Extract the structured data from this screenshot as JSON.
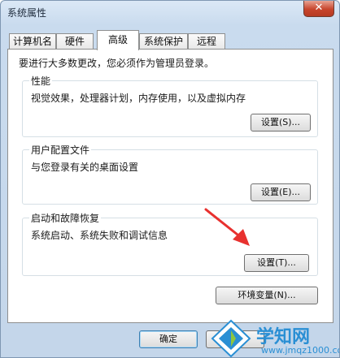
{
  "window": {
    "title": "系统属性",
    "close_label": "✕"
  },
  "tabs": [
    {
      "label": "计算机名",
      "active": false
    },
    {
      "label": "硬件",
      "active": false
    },
    {
      "label": "高级",
      "active": true
    },
    {
      "label": "系统保护",
      "active": false
    },
    {
      "label": "远程",
      "active": false
    }
  ],
  "intro": "要进行大多数更改，您必须作为管理员登录。",
  "groups": {
    "performance": {
      "title": "性能",
      "desc": "视觉效果，处理器计划，内存使用，以及虚拟内存",
      "button": "设置(S)..."
    },
    "profiles": {
      "title": "用户配置文件",
      "desc": "与您登录有关的桌面设置",
      "button": "设置(E)..."
    },
    "startup": {
      "title": "启动和故障恢复",
      "desc": "系统启动、系统失败和调试信息",
      "button": "设置(T)..."
    }
  },
  "env_button": "环境变量(N)...",
  "footer": {
    "ok_label": "确定"
  },
  "watermark": {
    "name": "学知网",
    "url": "www.jmqz1000.com"
  },
  "colors": {
    "arrow": "#e8312f",
    "watermark": "#2a8fd4",
    "close": "#c7452c"
  }
}
